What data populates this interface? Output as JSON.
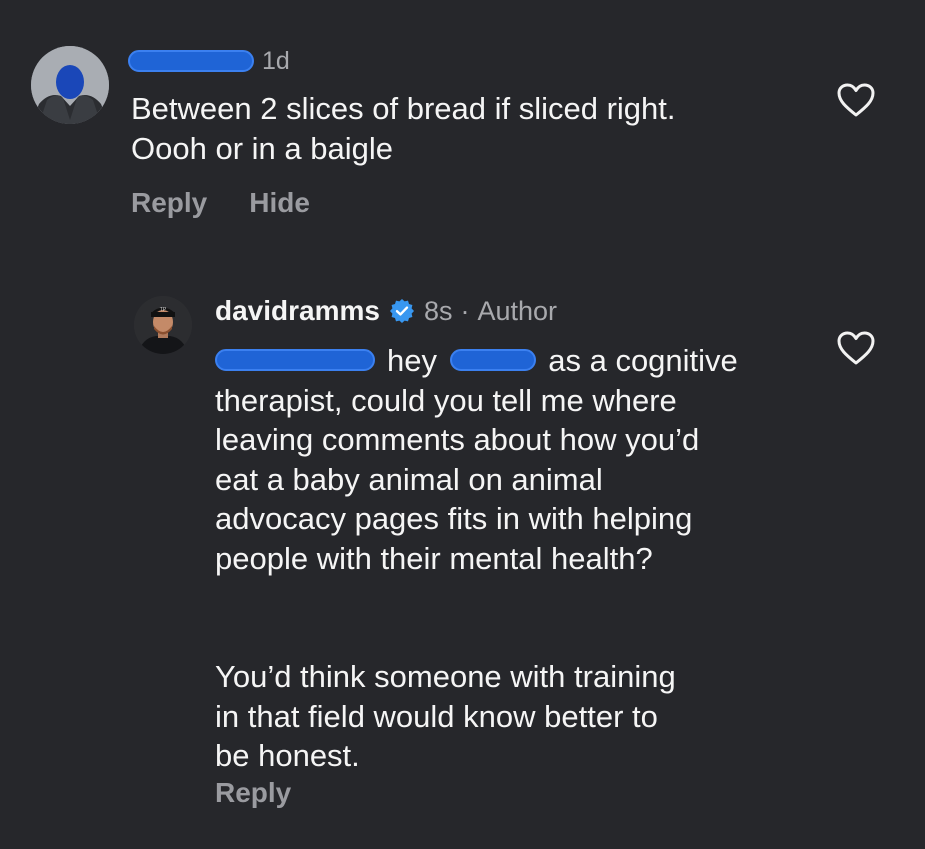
{
  "comment": {
    "time": "1d",
    "text_lines": [
      "Between 2 slices of bread if sliced right.",
      "Oooh or in a baigle"
    ],
    "reply_label": "Reply",
    "hide_label": "Hide"
  },
  "reply": {
    "username": "davidramms",
    "time": "8s",
    "separator": "·",
    "author_label": "Author",
    "line1_word1": "hey",
    "line1_rest": "as a cognitive",
    "lines": [
      "therapist, could you tell me where",
      "leaving comments about how you’d",
      "eat a baby animal on animal",
      "advocacy pages fits in with helping",
      "people with their mental health?"
    ],
    "para2_lines": [
      "You’d think someone with training",
      "in that field would know better to",
      "be honest."
    ],
    "reply_label": "Reply"
  },
  "icons": {
    "like": "heart-outline-icon",
    "verified": "verified-badge-icon"
  },
  "colors": {
    "background": "#26272b",
    "text": "#f5f5f5",
    "muted": "#a8a9ad",
    "verified": "#3897f0",
    "redaction": "#1f64d6"
  }
}
